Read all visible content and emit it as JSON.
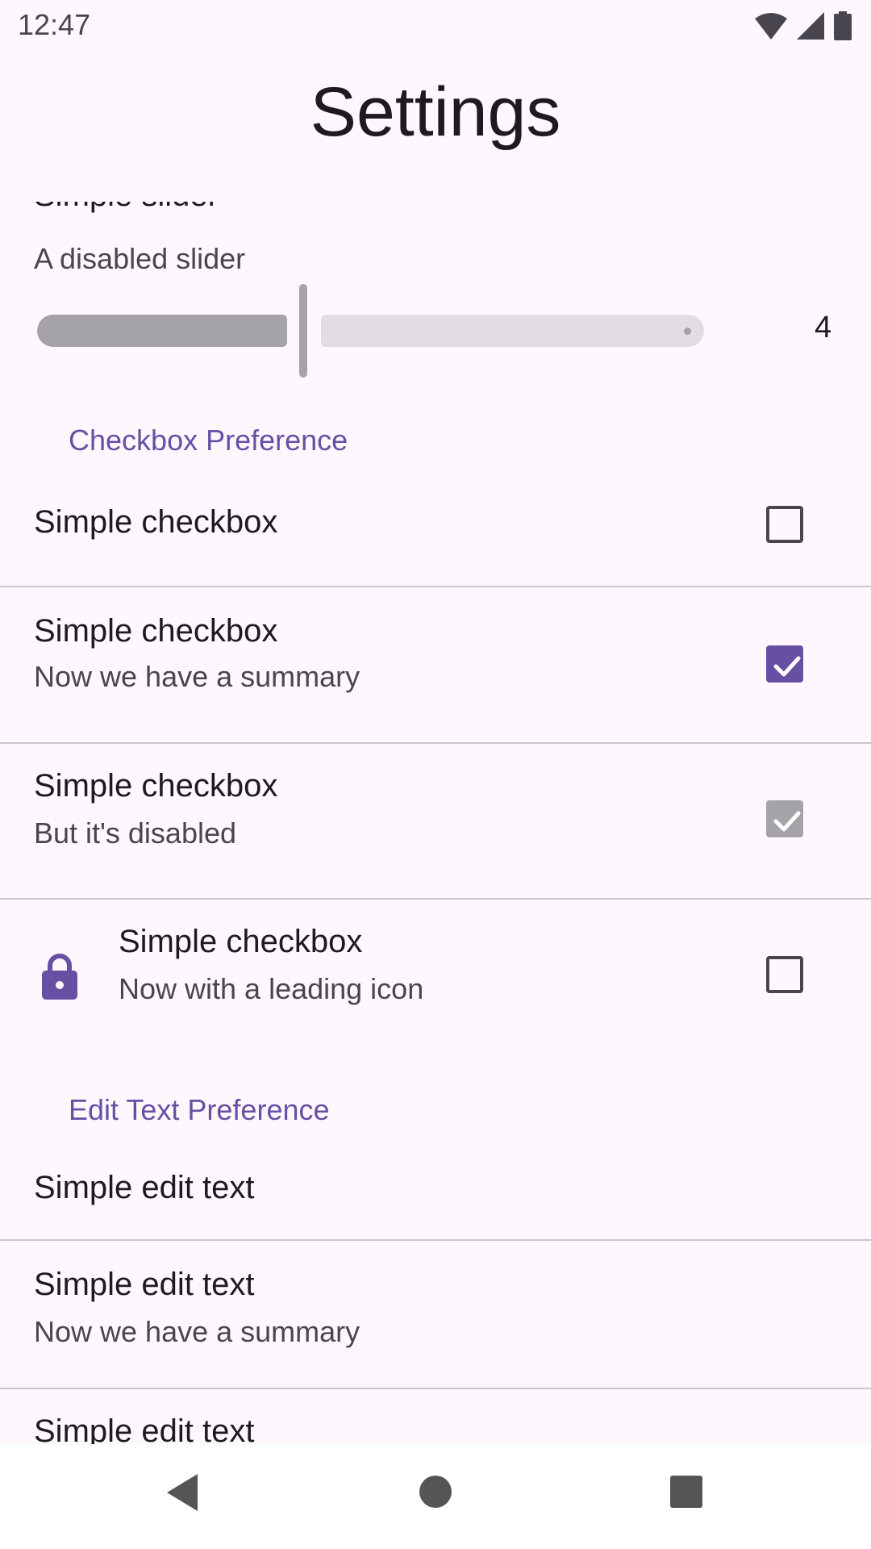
{
  "status_bar": {
    "time": "12:47"
  },
  "app_title": "Settings",
  "slider": {
    "title": "Simple slider",
    "summary": "A disabled slider",
    "value": "4",
    "level": 0.4
  },
  "sections": {
    "checkbox": "Checkbox Preference",
    "edit_text": "Edit Text Preference"
  },
  "checkbox_rows": [
    {
      "title": "Simple checkbox",
      "summary": "",
      "state": "unchecked"
    },
    {
      "title": "Simple checkbox",
      "summary": "Now we have a summary",
      "state": "checked"
    },
    {
      "title": "Simple checkbox",
      "summary": "But it's disabled",
      "state": "checked-disabled"
    },
    {
      "title": "Simple checkbox",
      "summary": "Now with a leading icon",
      "state": "unchecked",
      "icon": "lock-icon"
    }
  ],
  "edit_text_rows": [
    {
      "title": "Simple edit text",
      "summary": ""
    },
    {
      "title": "Simple edit text",
      "summary": "Now we have a summary"
    },
    {
      "title": "Simple edit text",
      "summary": ""
    }
  ],
  "colors": {
    "accent": "#6750A4",
    "background": "#FFF7FE",
    "disabled": "#A6A2A9"
  },
  "navigation": {
    "back": "back-icon",
    "home": "home-icon",
    "recents": "recents-icon"
  }
}
